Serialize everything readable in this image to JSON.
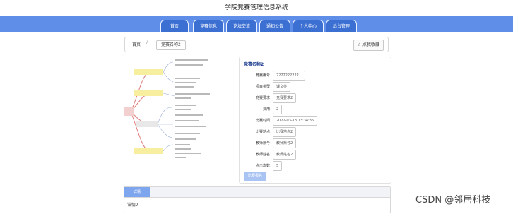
{
  "header": {
    "title": "学院竞赛管理信息系统"
  },
  "nav": {
    "items": [
      {
        "label": "首页"
      },
      {
        "label": "竞赛信息"
      },
      {
        "label": "论坛交流"
      },
      {
        "label": "通知公告"
      },
      {
        "label": "个人中心"
      },
      {
        "label": "后台管理"
      }
    ]
  },
  "breadcrumb": {
    "home": "首页",
    "separator": "/",
    "current": "竞赛名称2"
  },
  "favorite": {
    "label": "☆ 点我收藏"
  },
  "detail": {
    "title": "竞赛名称2",
    "fields": [
      {
        "label": "竞赛编号：",
        "value": "2222222222"
      },
      {
        "label": "项目类型：",
        "value": "课文类"
      },
      {
        "label": "竞赛要求：",
        "value": "竞赛要求2"
      },
      {
        "label": "费用：",
        "value": "2"
      },
      {
        "label": "比赛时间：",
        "value": "2022-03-13 13:34:36"
      },
      {
        "label": "比赛地点：",
        "value": "比赛地点2"
      },
      {
        "label": "教师账号：",
        "value": "教师账号2"
      },
      {
        "label": "教师姓名：",
        "value": "教师姓名2"
      },
      {
        "label": "点击次数：",
        "value": "5"
      }
    ],
    "signup_label": "比赛报名"
  },
  "tabs": {
    "active": "详情",
    "content": "详情2"
  },
  "watermark": "CSDN @邻居科技",
  "colors": {
    "nav": "#5f8ee8",
    "nav_button": "#3c6fd2",
    "accent": "#7ea6ee"
  }
}
